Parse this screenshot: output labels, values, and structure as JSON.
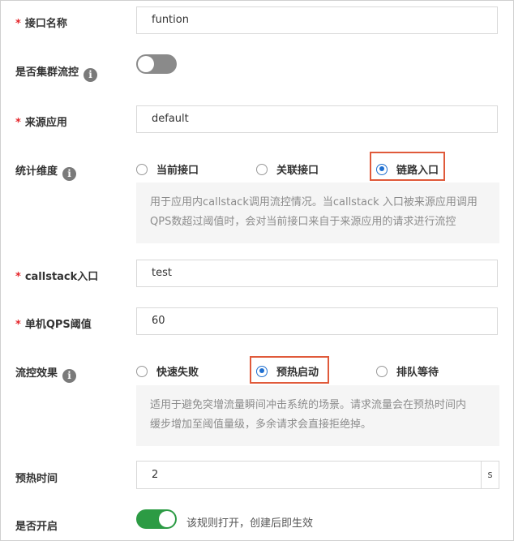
{
  "fields": {
    "api_name": {
      "label": "接口名称",
      "value": "funtion"
    },
    "cluster": {
      "label": "是否集群流控",
      "enabled": false
    },
    "source_app": {
      "label": "来源应用",
      "value": "default"
    },
    "strategy": {
      "label": "统计维度",
      "options": [
        "当前接口",
        "关联接口",
        "链路入口"
      ],
      "selected": "链路入口",
      "help_lines": [
        "用于应用内callstack调用流控情况。当callstack 入口被来源应用调用",
        "QPS数超过阈值时，会对当前接口来自于来源应用的请求进行流控"
      ]
    },
    "callstack_entry": {
      "label": "callstack入口",
      "value": "test"
    },
    "qps_threshold": {
      "label": "单机QPS阈值",
      "value": "60"
    },
    "control_behavior": {
      "label": "流控效果",
      "options": [
        "快速失败",
        "预热启动",
        "排队等待"
      ],
      "selected": "预热启动",
      "help_lines": [
        "适用于避免突增流量瞬间冲击系统的场景。请求流量会在预热时间内",
        "缓步增加至阈值量级，多余请求会直接拒绝掉。"
      ]
    },
    "warmup_time": {
      "label": "预热时间",
      "value": "2",
      "unit": "s"
    },
    "enable": {
      "label": "是否开启",
      "enabled": true,
      "hint": "该规则打开，创建后即生效"
    }
  },
  "required_mark": "*",
  "info_icon_glyph": "i",
  "colors": {
    "required": "#e5252a",
    "toggle_on": "#2c9b44",
    "toggle_off": "#8a8a8a",
    "radio_checked": "#1f6fd0",
    "highlight": "#e05a3a"
  }
}
